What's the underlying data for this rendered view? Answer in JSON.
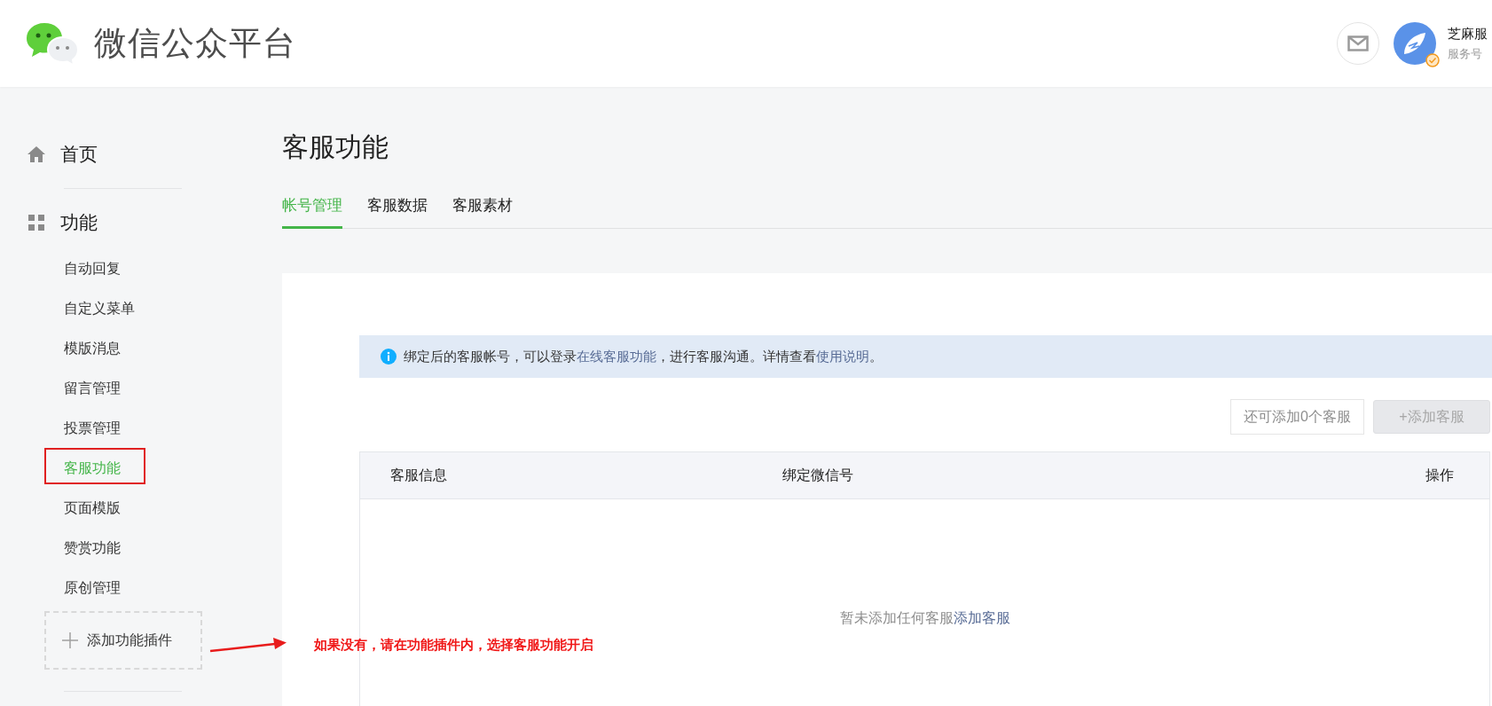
{
  "header": {
    "logo_title": "微信公众平台",
    "account": {
      "name": "芝麻服",
      "type": "服务号",
      "verified": true
    }
  },
  "sidebar": {
    "sections": [
      {
        "label": "首页",
        "kind": "home"
      },
      {
        "label": "功能",
        "kind": "functions",
        "items": [
          {
            "label": "自动回复",
            "selected": false,
            "annotated": false
          },
          {
            "label": "自定义菜单",
            "selected": false,
            "annotated": false
          },
          {
            "label": "模版消息",
            "selected": false,
            "annotated": false
          },
          {
            "label": "留言管理",
            "selected": false,
            "annotated": false
          },
          {
            "label": "投票管理",
            "selected": false,
            "annotated": false
          },
          {
            "label": "客服功能",
            "selected": true,
            "annotated": true
          },
          {
            "label": "页面模版",
            "selected": false,
            "annotated": false
          },
          {
            "label": "赞赏功能",
            "selected": false,
            "annotated": false
          },
          {
            "label": "原创管理",
            "selected": false,
            "annotated": false
          }
        ]
      }
    ],
    "add_plugin": "添加功能插件"
  },
  "page": {
    "title": "客服功能",
    "tabs": [
      {
        "label": "帐号管理",
        "selected": true
      },
      {
        "label": "客服数据",
        "selected": false
      },
      {
        "label": "客服素材",
        "selected": false
      }
    ],
    "notice": [
      {
        "kind": "text",
        "text": "绑定后的客服帐号，可以登录"
      },
      {
        "kind": "link",
        "text": "在线客服功能"
      },
      {
        "kind": "text",
        "text": "，进行客服沟通。详情查看"
      },
      {
        "kind": "link",
        "text": "使用说明"
      },
      {
        "kind": "text",
        "text": "。"
      }
    ],
    "quota": "还可添加0个客服",
    "add_button": {
      "label": "+添加客服",
      "disabled": true
    },
    "table": {
      "columns": [
        "客服信息",
        "绑定微信号",
        "操作"
      ],
      "empty_text": "暂未添加任何客服",
      "empty_link": "添加客服"
    }
  },
  "annotation": {
    "text": "如果没有，请在功能插件内，选择客服功能开启"
  }
}
